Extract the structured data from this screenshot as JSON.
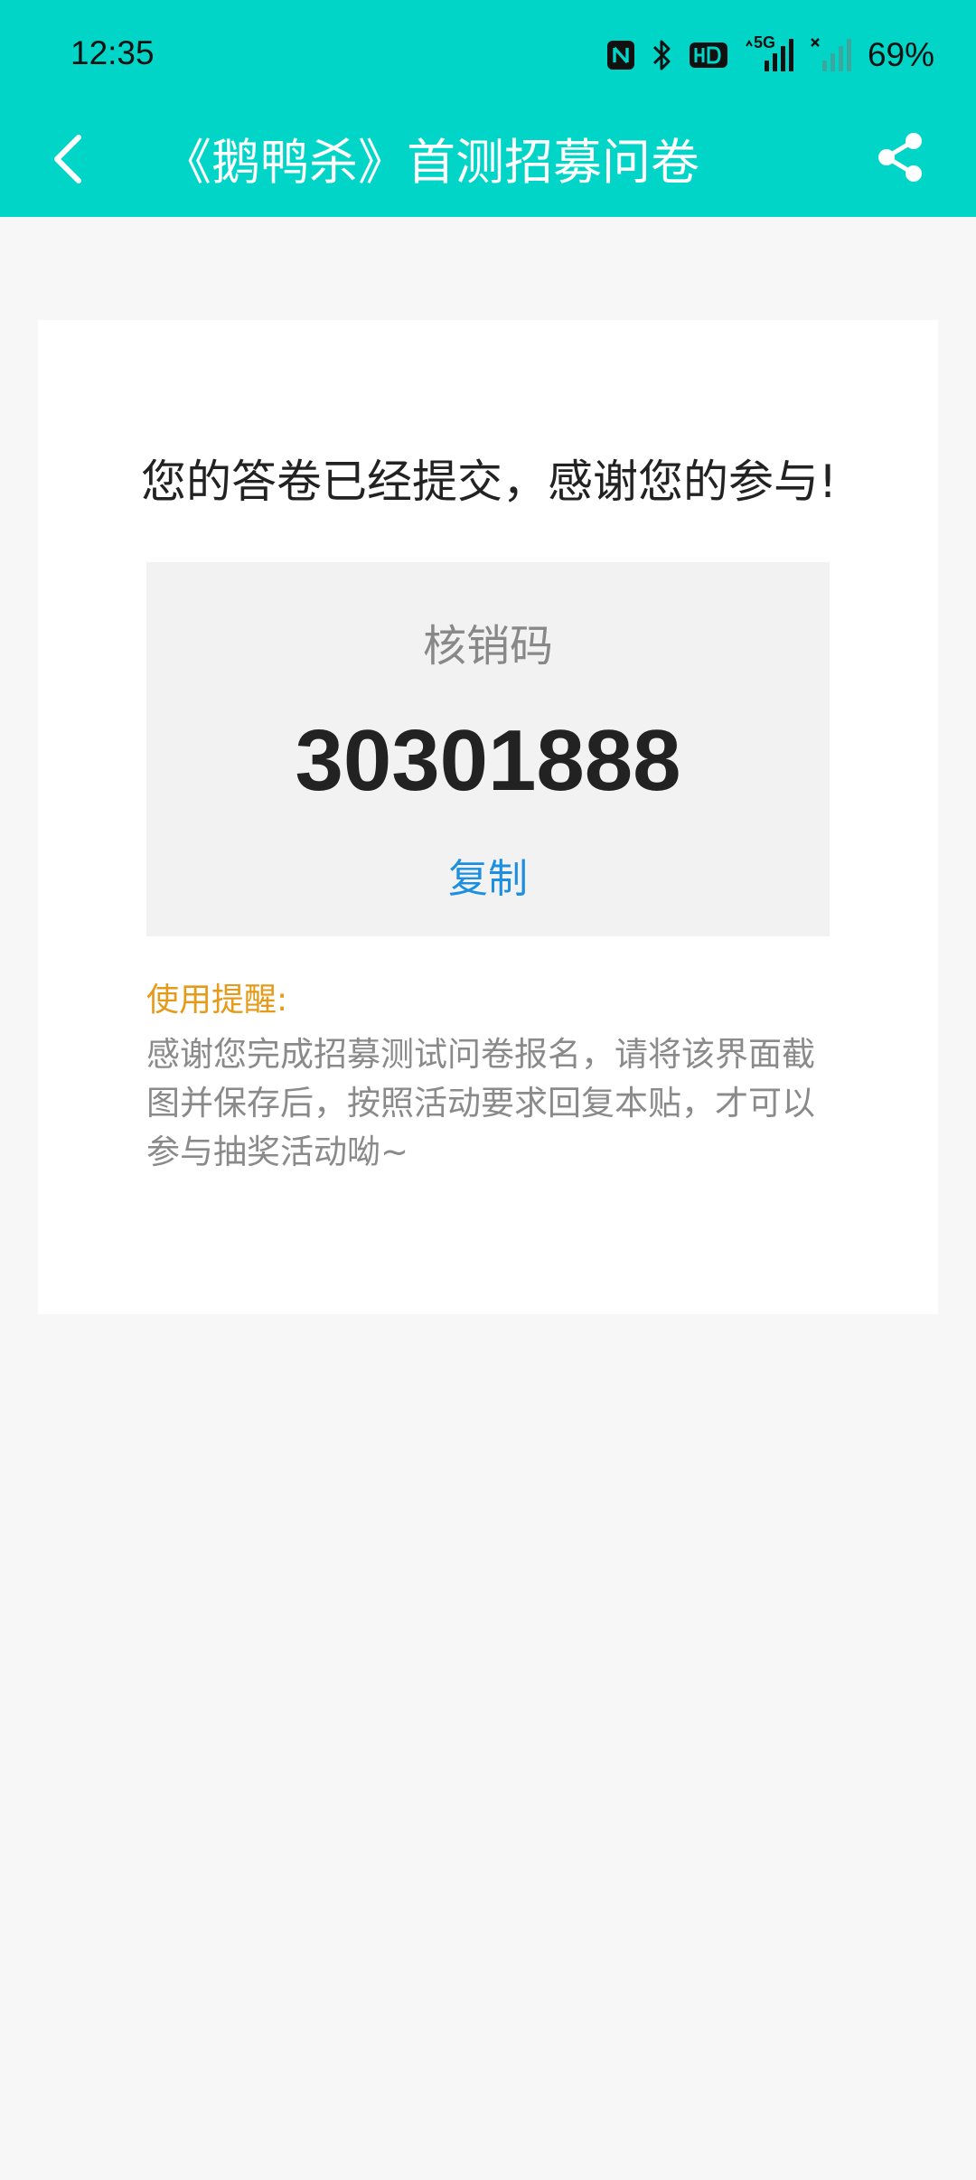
{
  "status_bar": {
    "time": "12:35",
    "network_label": "5G",
    "battery": "69%"
  },
  "header": {
    "title": "《鹅鸭杀》首测招募问卷"
  },
  "card": {
    "thanks": "您的答卷已经提交，感谢您的参与!",
    "code_label": "核销码",
    "code_value": "30301888",
    "copy_label": "复制",
    "reminder_title": "使用提醒:",
    "reminder_text": "感谢您完成招募测试问卷报名，请将该界面截图并保存后，按照活动要求回复本贴，才可以参与抽奖活动呦~"
  },
  "icons": {
    "back": "chevron-left-icon",
    "share": "share-icon",
    "nfc": "nfc-icon",
    "bluetooth": "bluetooth-icon",
    "hd": "hd-icon",
    "signal_1": "signal-5g-icon",
    "signal_2": "signal-no-sim-icon"
  },
  "colors": {
    "header_bg": "#00d5c8",
    "page_bg": "#f7f7f7",
    "copy_link": "#1c8fe0",
    "reminder_title": "#e69a1a"
  }
}
